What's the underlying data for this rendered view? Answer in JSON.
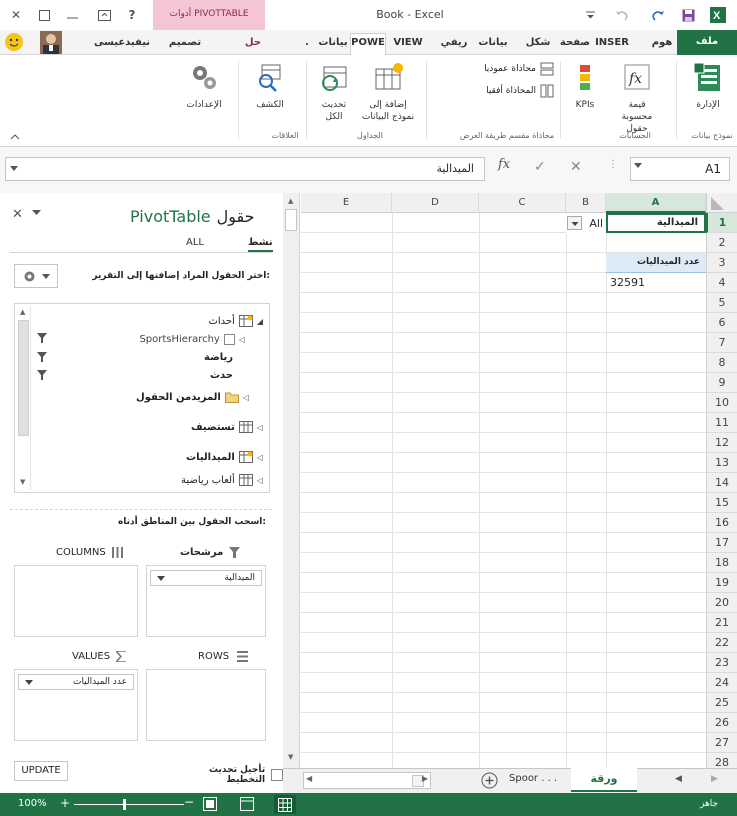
{
  "window": {
    "title": "Book - Excel",
    "pivot_tools_label": "أدوات PIVOTTABLE",
    "user_name": "نيفيدعيسى"
  },
  "tabs": [
    "ملف",
    "هوم",
    "INSER",
    "صفحة",
    "شكل",
    "بيانات",
    "ريفي",
    "VIEW",
    "POWE",
    "بيانات",
    "تحليل",
    "تصميم"
  ],
  "tab_data_label": "بيانات",
  "tab_analyze_label": "حل",
  "tab_design_label": "تصميم",
  "ribbon": {
    "manage_label": "الإدارة",
    "manage_group": "نموذج بيانات",
    "calc_field_label": "قيمة محسوبة",
    "calc_field_label2": "حقول",
    "kpi_label": "KPIs",
    "calc_group": "الحسابات",
    "align_vertical": "محاذاة عموديا",
    "align_horizontal": "المحاذاة أفقيا",
    "view_group": "محاذاة مقسم طريقة العرض",
    "add_to_model": "إضافة إلى",
    "add_to_model2": "نموذج البيانات",
    "refresh_all": "تحديث",
    "refresh_all2": "الكل",
    "tables_group": "الجداول",
    "detect_label": "الكشف",
    "relations_group": "العلاقات",
    "settings_label": "الإعدادات"
  },
  "formula": {
    "namebox": "A1",
    "value": "الميدالية"
  },
  "pane": {
    "title_left": "حقول",
    "title_right": "PivotTable",
    "tab_active": "نشط",
    "tab_all": "ALL",
    "choose_fields": "اختر الحقول المراد إضافتها إلى التقرير:",
    "fields": [
      {
        "label": "أحداث",
        "type": "table",
        "expanded": true
      },
      {
        "label": "SportsHierarchy",
        "type": "hierarchy"
      },
      {
        "label": "رياضة",
        "type": "field"
      },
      {
        "label": "حدث",
        "type": "field"
      },
      {
        "label": "المزيدمن الحقول",
        "type": "folder"
      },
      {
        "label": "تستضيف",
        "type": "table"
      },
      {
        "label": "الميداليات",
        "type": "table"
      },
      {
        "label": "ألعاب رياضية",
        "type": "table"
      }
    ],
    "drag_hint": "اسحب الحقول بين المناطق أدناه:",
    "filters_label": "مرشحات",
    "columns_label": "COLUMNS",
    "rows_label": "ROWS",
    "values_label": "VALUES",
    "filter_item": "الميدالية",
    "values_item": "عدد الميداليات",
    "defer_label": "تأجيل تحديث التخطيط",
    "update_button": "UPDATE"
  },
  "grid": {
    "columns": [
      "A",
      "B",
      "C",
      "D",
      "E"
    ],
    "rows": [
      "1",
      "2",
      "3",
      "4",
      "5",
      "6",
      "7",
      "8",
      "9",
      "10",
      "11",
      "12",
      "13",
      "14",
      "15",
      "16",
      "17",
      "18",
      "19",
      "20",
      "21",
      "22",
      "23",
      "24",
      "25",
      "26",
      "27",
      "28"
    ],
    "a1": "الميدالية",
    "b1": "All",
    "a3": "عدد الميداليات",
    "a4": "32591"
  },
  "sheets": {
    "active": "ورقة",
    "other": "Spoor . . ."
  },
  "status": {
    "ready": "جاهز",
    "zoom": "100%"
  },
  "colors": {
    "excel_green": "#217346",
    "pivot_pink": "#f4c6d3",
    "header_gray": "#f0f0f0"
  }
}
